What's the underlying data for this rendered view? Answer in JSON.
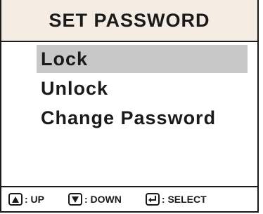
{
  "title": "SET PASSWORD",
  "menu": {
    "items": [
      {
        "label": "Lock",
        "selected": true
      },
      {
        "label": "Unlock",
        "selected": false
      },
      {
        "label": "Change Password",
        "selected": false
      }
    ]
  },
  "footer": {
    "up_label": ": UP",
    "down_label": ": DOWN",
    "select_label": ": SELECT"
  },
  "icons": {
    "up": "up-arrow-key-icon",
    "down": "down-arrow-key-icon",
    "select": "enter-key-icon"
  },
  "colors": {
    "title_bg": "#f5ede3",
    "highlight": "#c8c8c8",
    "text": "#1a1a1a"
  }
}
